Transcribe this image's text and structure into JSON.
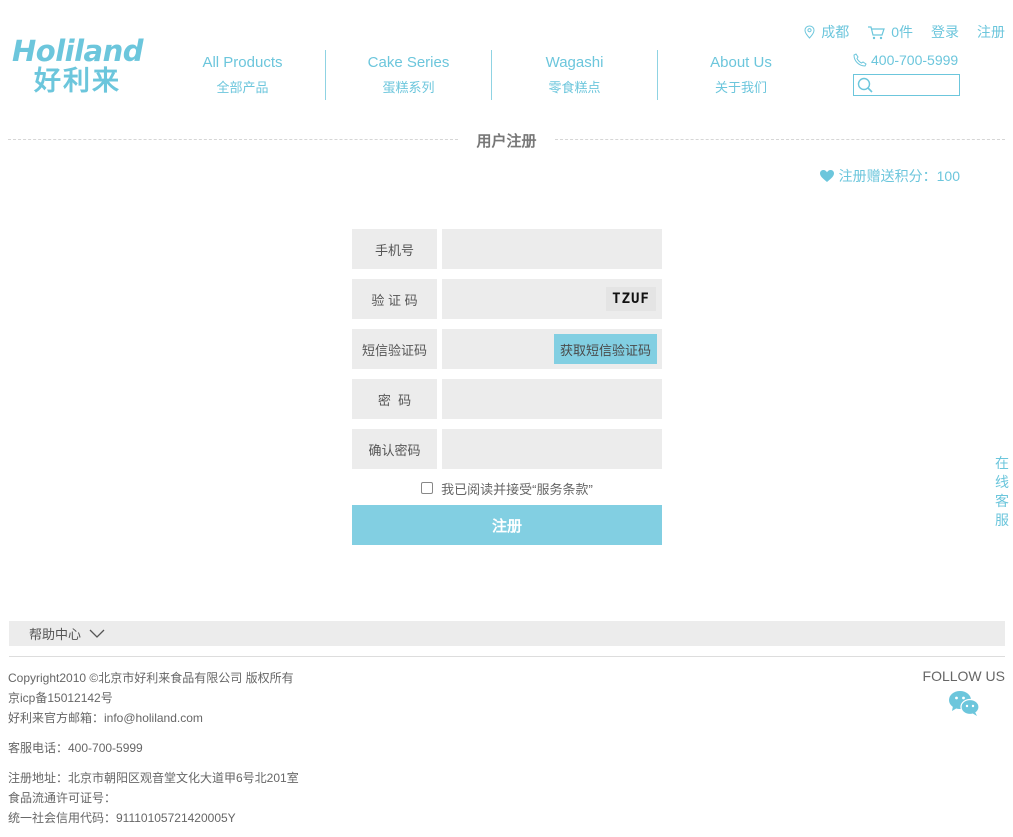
{
  "topbar": {
    "city": "成都",
    "cart": "0件",
    "login": "登录",
    "register": "注册"
  },
  "logo": {
    "en": "Holiland",
    "cn": "好利来"
  },
  "nav": [
    {
      "en": "All Products",
      "cn": "全部产品"
    },
    {
      "en": "Cake Series",
      "cn": "蛋糕系列"
    },
    {
      "en": "Wagashi",
      "cn": "零食糕点"
    },
    {
      "en": "About Us",
      "cn": "关于我们"
    }
  ],
  "phone": "400-700-5999",
  "search": {
    "value": ""
  },
  "section_title": "用户注册",
  "bonus": "注册赠送积分：100",
  "form": {
    "mobile_label": "手机号",
    "captcha_label": "验 证 码",
    "captcha_code": "TZUF",
    "sms_label": "短信验证码",
    "sms_button": "获取短信验证码",
    "password_label": "密  码",
    "confirm_label": "确认密码",
    "agree_text": "我已阅读并接受“服务条款”",
    "submit": "注册"
  },
  "side_service": [
    "在",
    "线",
    "客",
    "服"
  ],
  "help": "帮助中心",
  "footer": {
    "copyright": "Copyright2010 ©北京市好利来食品有限公司 版权所有",
    "icp": "京icp备15012142号",
    "email": "好利来官方邮箱：info@holiland.com",
    "service_phone": "客服电话：400-700-5999",
    "address": "注册地址：北京市朝阳区观音堂文化大道甲6号北201室",
    "license": "食品流通许可证号：",
    "credit_code": "统一社会信用代码：91110105721420005Y",
    "follow": "FOLLOW US"
  },
  "colors": {
    "accent": "#6cc6dc",
    "button": "#82cfe2",
    "field_bg": "#ececec"
  }
}
